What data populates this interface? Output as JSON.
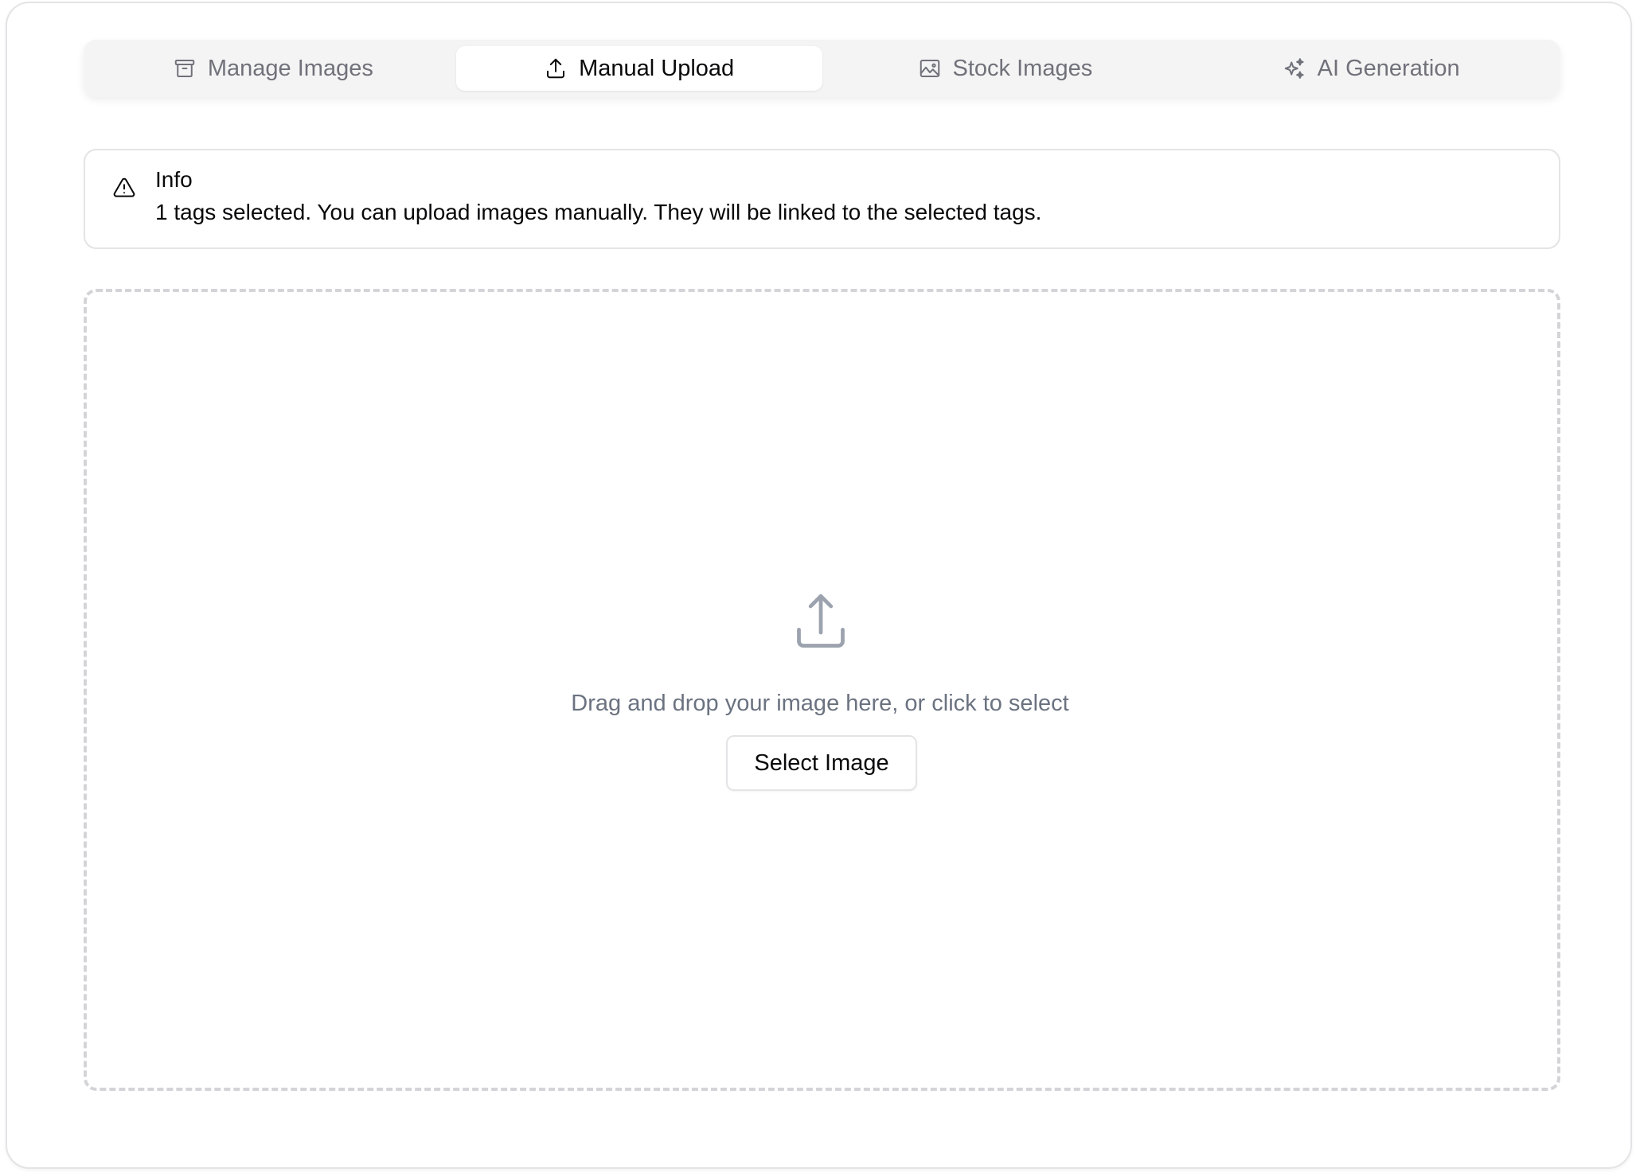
{
  "tabs": [
    {
      "label": "Manage Images",
      "icon": "archive-icon",
      "active": false
    },
    {
      "label": "Manual Upload",
      "icon": "upload-icon",
      "active": true
    },
    {
      "label": "Stock Images",
      "icon": "image-icon",
      "active": false
    },
    {
      "label": "AI Generation",
      "icon": "sparkles-icon",
      "active": false
    }
  ],
  "alert": {
    "icon": "warning-triangle-icon",
    "title": "Info",
    "description": "1 tags selected. You can upload images manually. They will be linked to the selected tags."
  },
  "dropzone": {
    "icon": "upload-icon",
    "text": "Drag and drop your image here, or click to select",
    "button_label": "Select Image"
  },
  "colors": {
    "muted_text": "#71717a",
    "dropzone_text": "#6b7280",
    "dropzone_border": "#d4d4d8",
    "tab_bar_bg": "#f4f4f5"
  }
}
